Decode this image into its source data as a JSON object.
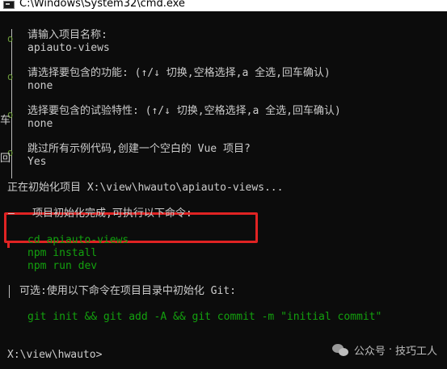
{
  "window": {
    "title": "C:\\Windows\\System32\\cmd.exe"
  },
  "prompts": [
    {
      "bullet": "o",
      "question": "请输入项目名称:",
      "answer": "apiauto-views"
    },
    {
      "bullet": "o",
      "question": "请选择要包含的功能: (↑/↓ 切换,空格选择,a 全选,回车确认)",
      "answer": "none"
    },
    {
      "bullet": "o",
      "question": "选择要包含的试验特性: (↑/↓ 切换,空格选择,a 全选,回车确认)",
      "answer": "none"
    },
    {
      "bullet": "o",
      "question": "跳过所有示例代码,创建一个空白的 Vue 项目?",
      "answer": "Yes"
    }
  ],
  "side_chars": {
    "c1": "车",
    "c2": "回"
  },
  "init_line": "正在初始化项目 X:\\view\\hwauto\\apiauto-views...",
  "done": {
    "bullet": "—",
    "text": "项目初始化完成,可执行以下命令:"
  },
  "commands": [
    "cd apiauto-views",
    "npm install",
    "npm run dev"
  ],
  "git_hint": "可选:使用以下命令在项目目录中初始化 Git:",
  "git_command": "git init && git add -A && git commit -m \"initial commit\"",
  "shell_prompt": "X:\\view\\hwauto>",
  "watermark": {
    "source": "公众号",
    "separator": "·",
    "name": "技巧工人"
  }
}
